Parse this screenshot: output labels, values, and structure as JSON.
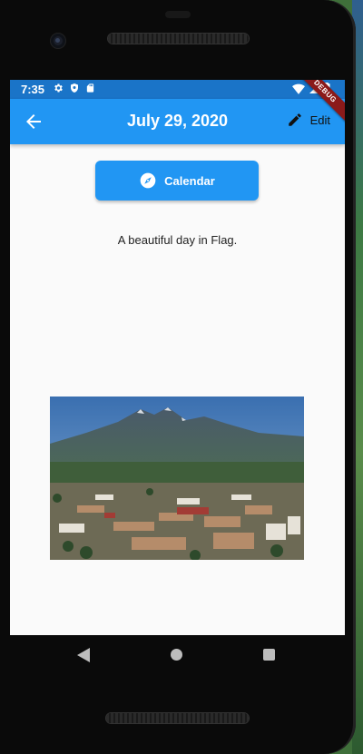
{
  "status_bar": {
    "time": "7:35",
    "left_icons": [
      "gear-icon",
      "shield-icon",
      "sd-card-icon"
    ],
    "right_icons": [
      "wifi-icon",
      "signal-icon",
      "battery-icon"
    ]
  },
  "app_bar": {
    "title": "July 29, 2020",
    "edit_label": "Edit",
    "debug_label": "DEBUG",
    "color": "#2196f3"
  },
  "main": {
    "calendar_button_label": "Calendar",
    "description": "A beautiful day in Flag."
  },
  "nav_bar": {
    "items": [
      "back-triangle-icon",
      "home-circle-icon",
      "recents-square-icon"
    ]
  },
  "colors": {
    "status_bar": "#1a74c8",
    "accent": "#2196f3",
    "screen_bg": "#fafafa"
  }
}
